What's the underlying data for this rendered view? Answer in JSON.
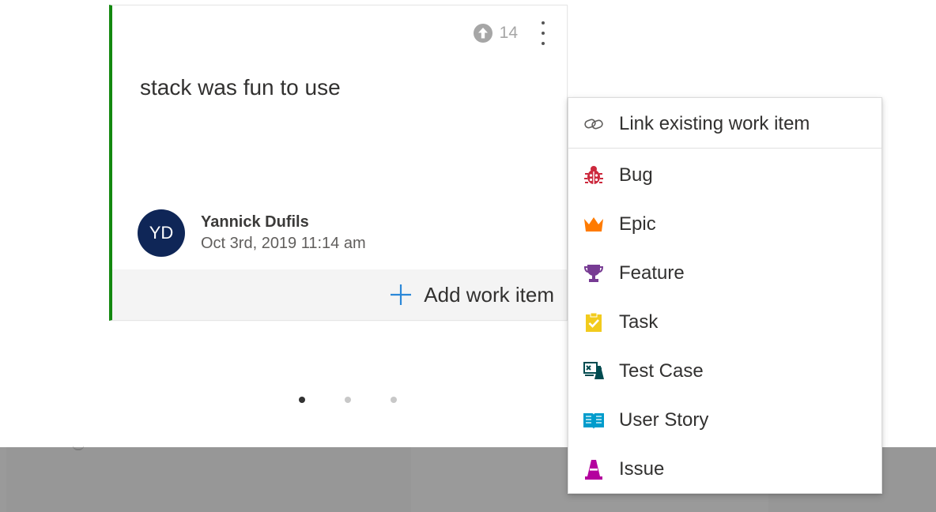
{
  "card": {
    "vote_count": "14",
    "text": "stack was fun to use",
    "author": {
      "initials": "YD",
      "name": "Yannick Dufils",
      "date": "Oct 3rd, 2019 11:14 am"
    },
    "add_work_item_label": "Add work item"
  },
  "pagination": {
    "total": 3,
    "active": 1
  },
  "menu": {
    "link_existing_label": "Link existing work item",
    "items": [
      {
        "label": "Bug",
        "icon": "bug-icon",
        "color": "#cc293d"
      },
      {
        "label": "Epic",
        "icon": "crown-icon",
        "color": "#ff7b00"
      },
      {
        "label": "Feature",
        "icon": "trophy-icon",
        "color": "#773b93"
      },
      {
        "label": "Task",
        "icon": "clipboard-check-icon",
        "color": "#f2cb1d"
      },
      {
        "label": "Test Case",
        "icon": "test-case-icon",
        "color": "#004b50"
      },
      {
        "label": "User Story",
        "icon": "book-icon",
        "color": "#009ccc"
      },
      {
        "label": "Issue",
        "icon": "issue-icon",
        "color": "#b4009e"
      }
    ]
  },
  "colors": {
    "card_accent": "#13880f",
    "avatar": "#0f2657",
    "add_plus": "#2b88d8"
  }
}
